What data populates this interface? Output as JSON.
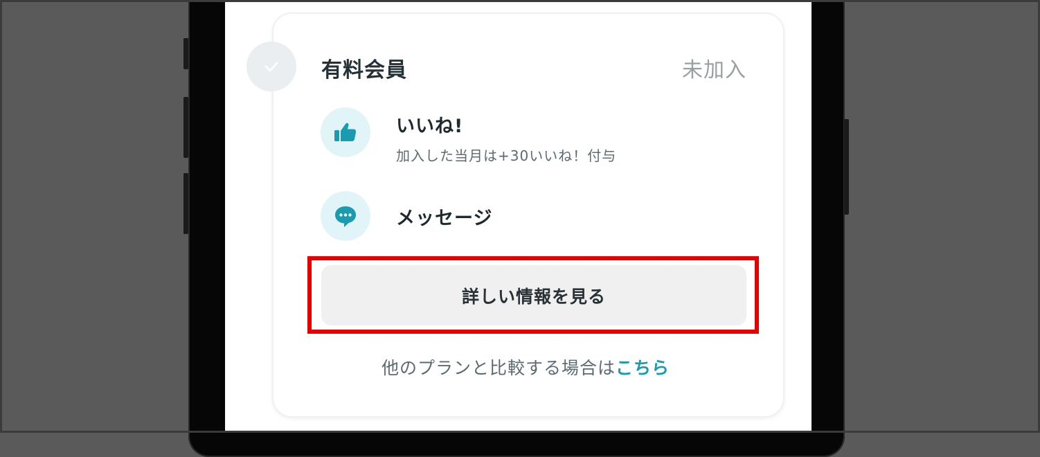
{
  "plan": {
    "title": "有料会員",
    "status": "未加入"
  },
  "features": [
    {
      "title": "いいね!",
      "description": "加入した当月は+30いいね！付与",
      "icon": "thumbs-up-icon"
    },
    {
      "title": "メッセージ",
      "description": "",
      "icon": "chat-bubble-icon"
    }
  ],
  "actions": {
    "details_button": "詳しい情報を見る",
    "compare_text": "他のプランと比較する場合は",
    "compare_link": "こちら"
  },
  "colors": {
    "accent": "#1a9bb0",
    "icon_background": "#e1f4f8",
    "highlight": "#e60000",
    "button_background": "#f0f0f0"
  }
}
